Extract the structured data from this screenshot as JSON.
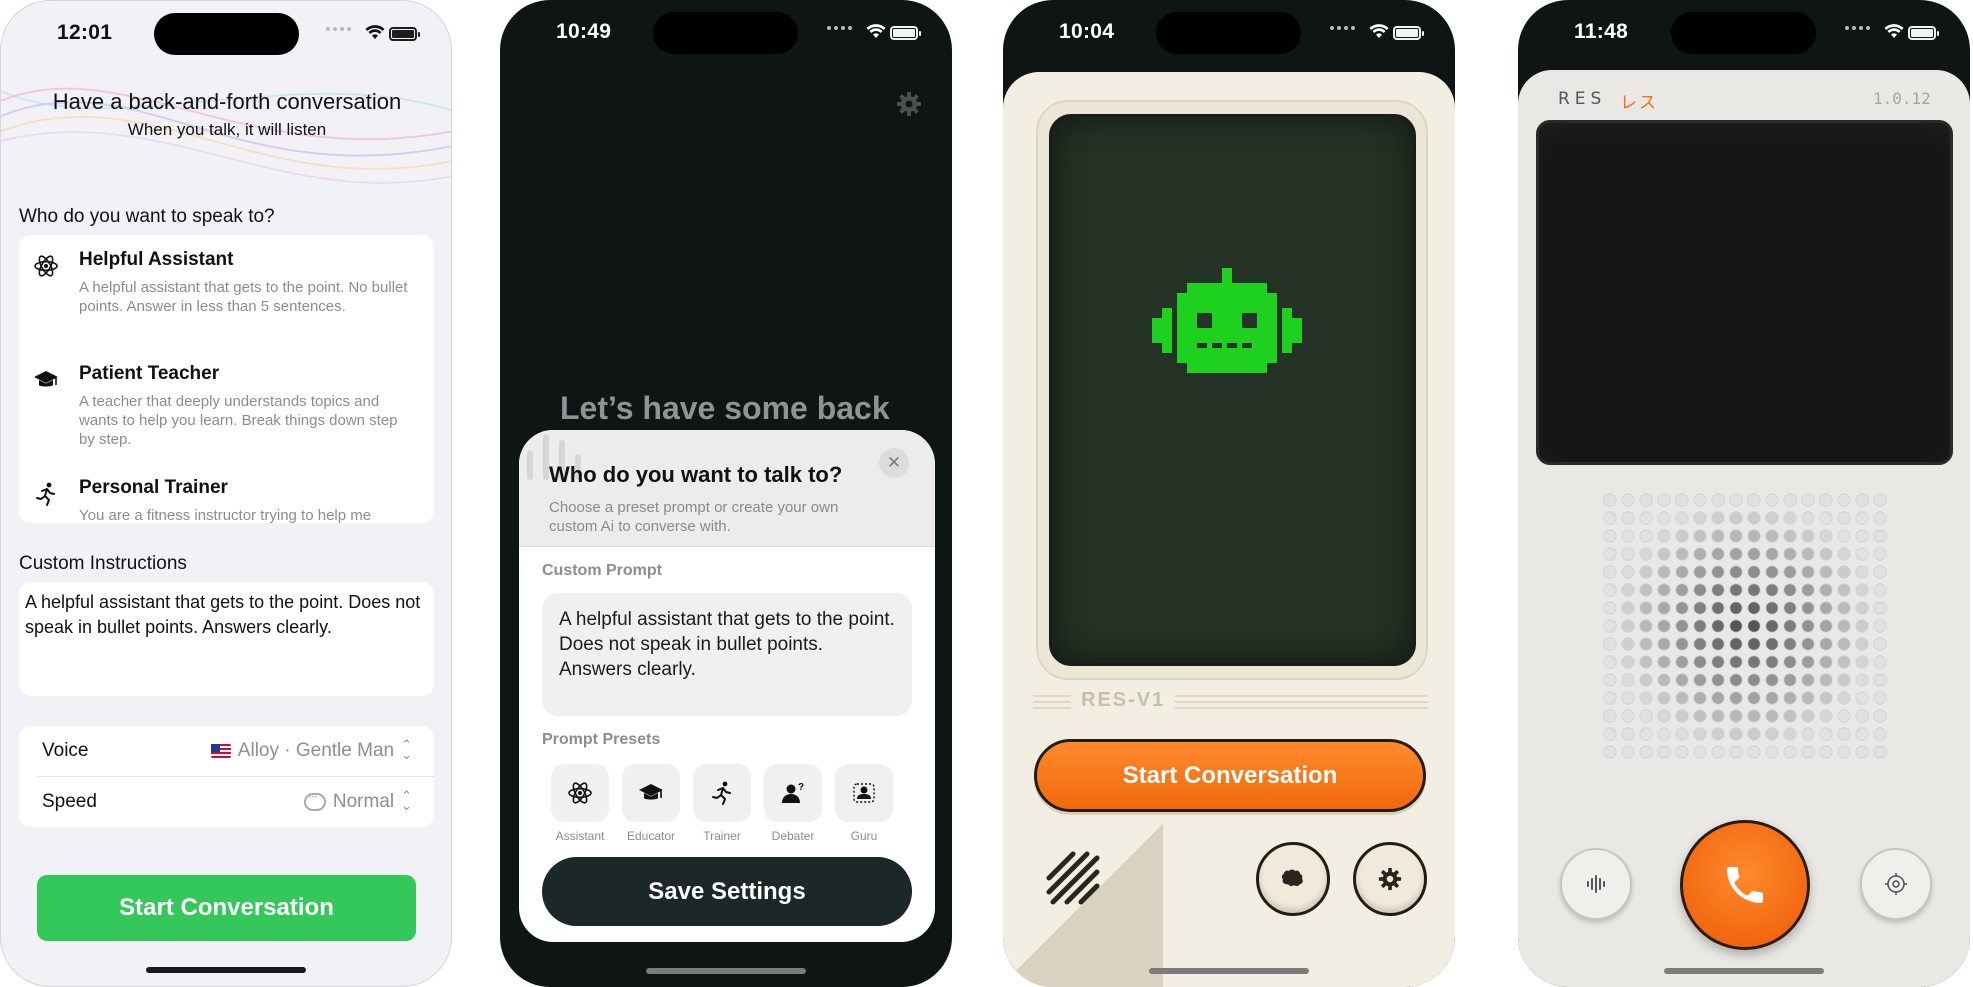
{
  "screens": [
    {
      "status_time": "12:01",
      "header": {
        "title": "Have a back-and-forth conversation",
        "subtitle": "When you talk, it will listen"
      },
      "who_label": "Who do you want to speak to?",
      "personas": [
        {
          "name": "Helpful Assistant",
          "description": "A helpful assistant that gets to the point. No bullet points. Answer in less than 5 sentences.",
          "icon": "atom-icon"
        },
        {
          "name": "Patient Teacher",
          "description": "A teacher that deeply understands topics and wants to help you learn. Break things down step by step.",
          "icon": "graduation-cap-icon"
        },
        {
          "name": "Personal Trainer",
          "description": "You are a fitness instructor trying to help me",
          "icon": "running-icon"
        }
      ],
      "custom_instructions_label": "Custom Instructions",
      "custom_instructions_text": "A helpful assistant that gets to the point. Does not speak in bullet points. Answers clearly.",
      "settings": {
        "voice_label": "Voice",
        "voice_value": "Alloy · Gentle Man",
        "speed_label": "Speed",
        "speed_value": "Normal"
      },
      "start_label": "Start Conversation",
      "accent": "#34c759"
    },
    {
      "status_time": "10:49",
      "background_text": "Let’s have some back",
      "sheet": {
        "title": "Who do you want to talk to?",
        "subtitle": "Choose a preset prompt or create your own custom Ai to converse with.",
        "custom_prompt_label": "Custom Prompt",
        "custom_prompt_text": "A helpful assistant that gets to the point. Does not speak in bullet points. Answers clearly.",
        "presets_label": "Prompt Presets",
        "presets": [
          {
            "label": "Assistant",
            "icon": "atom-icon"
          },
          {
            "label": "Educator",
            "icon": "graduation-cap-icon"
          },
          {
            "label": "Trainer",
            "icon": "running-icon"
          },
          {
            "label": "Debater",
            "icon": "debater-icon"
          },
          {
            "label": "Guru",
            "icon": "guru-icon"
          }
        ],
        "save_label": "Save Settings"
      }
    },
    {
      "status_time": "10:04",
      "model_label": "RES-V1",
      "start_label": "Start Conversation",
      "accent": "#f47a1f",
      "robot_color": "#1fd11f"
    },
    {
      "status_time": "11:48",
      "brand": "RES",
      "brand_jp": "レス",
      "version": "1.0.12",
      "accent": "#ff6a1a"
    }
  ]
}
